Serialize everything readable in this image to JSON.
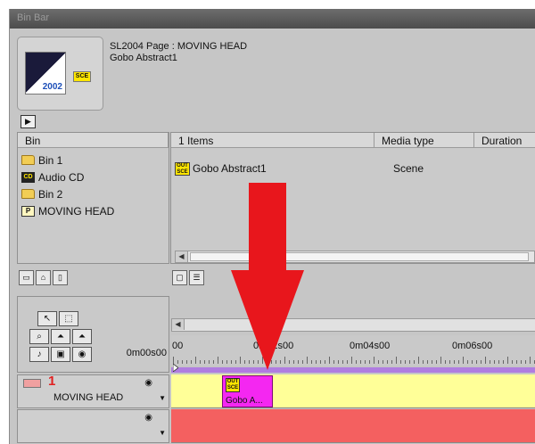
{
  "window": {
    "title": "Bin Bar"
  },
  "preview": {
    "line1": "SL2004 Page : MOVING HEAD",
    "line2": "Gobo Abstract1",
    "thumb_year": "2002",
    "thumb_badge": "SCE",
    "play_icon": "play-icon"
  },
  "bin_panel": {
    "header": "Bin",
    "items": [
      {
        "label": "Bin 1",
        "icon": "folder-icon"
      },
      {
        "label": "Audio CD",
        "icon": "cd-icon",
        "icon_text": "CD"
      },
      {
        "label": "Bin 2",
        "icon": "folder-icon"
      },
      {
        "label": "MOVING HEAD",
        "icon": "page-icon",
        "icon_text": "P"
      }
    ]
  },
  "items_panel": {
    "columns": [
      "1 Items",
      "Media type",
      "Duration"
    ],
    "rows": [
      {
        "name": "Gobo Abstract1",
        "media_type": "Scene",
        "duration": ""
      }
    ],
    "icon_text": [
      "OUT",
      "SCE"
    ]
  },
  "timeline": {
    "start_time": "0m00s00",
    "ruler_labels": [
      "00",
      "0m02s00",
      "0m04s00",
      "0m06s00"
    ],
    "tracks": [
      {
        "number": "1",
        "name": "MOVING HEAD",
        "color": "#ffff98"
      },
      {
        "number": "",
        "name": "",
        "color": "#f46060"
      },
      {
        "number": "",
        "name": "",
        "color": "#9d90e6"
      }
    ],
    "clip": {
      "label": "Gobo A...",
      "color": "#f427f1",
      "icon_text": [
        "OUT",
        "SCE"
      ]
    }
  },
  "annotation": {
    "arrow_color": "#e8161c"
  }
}
